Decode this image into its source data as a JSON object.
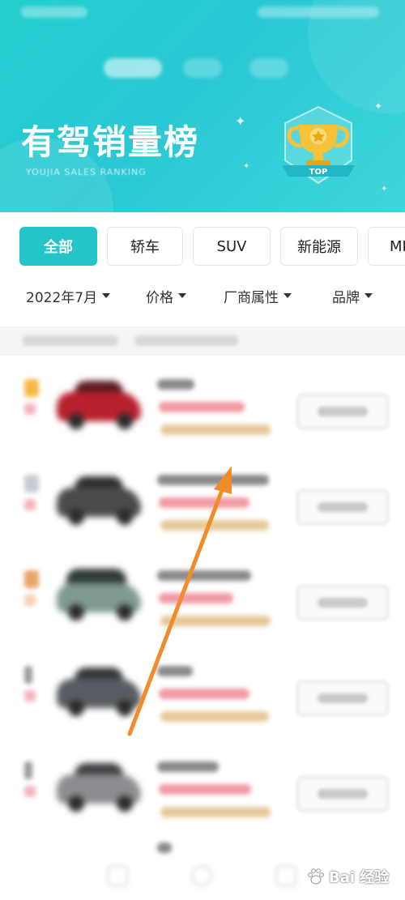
{
  "banner": {
    "title": "有驾销量榜",
    "subtitle": "YOUJIA SALES RANKING",
    "badge_text": "TOP",
    "accent_color": "#25c4c8"
  },
  "categories": [
    {
      "label": "全部",
      "active": true
    },
    {
      "label": "轿车",
      "active": false
    },
    {
      "label": "SUV",
      "active": false
    },
    {
      "label": "新能源",
      "active": false
    },
    {
      "label": "MP",
      "active": false
    }
  ],
  "filters": [
    {
      "label": "2022年7月",
      "icon": "caret-down-icon"
    },
    {
      "label": "价格",
      "icon": "caret-down-icon"
    },
    {
      "label": "厂商属性",
      "icon": "caret-down-icon"
    },
    {
      "label": "品牌",
      "icon": "caret-down-icon"
    }
  ],
  "watermark": {
    "text": "Bai 经验",
    "icon": "paw-icon"
  }
}
